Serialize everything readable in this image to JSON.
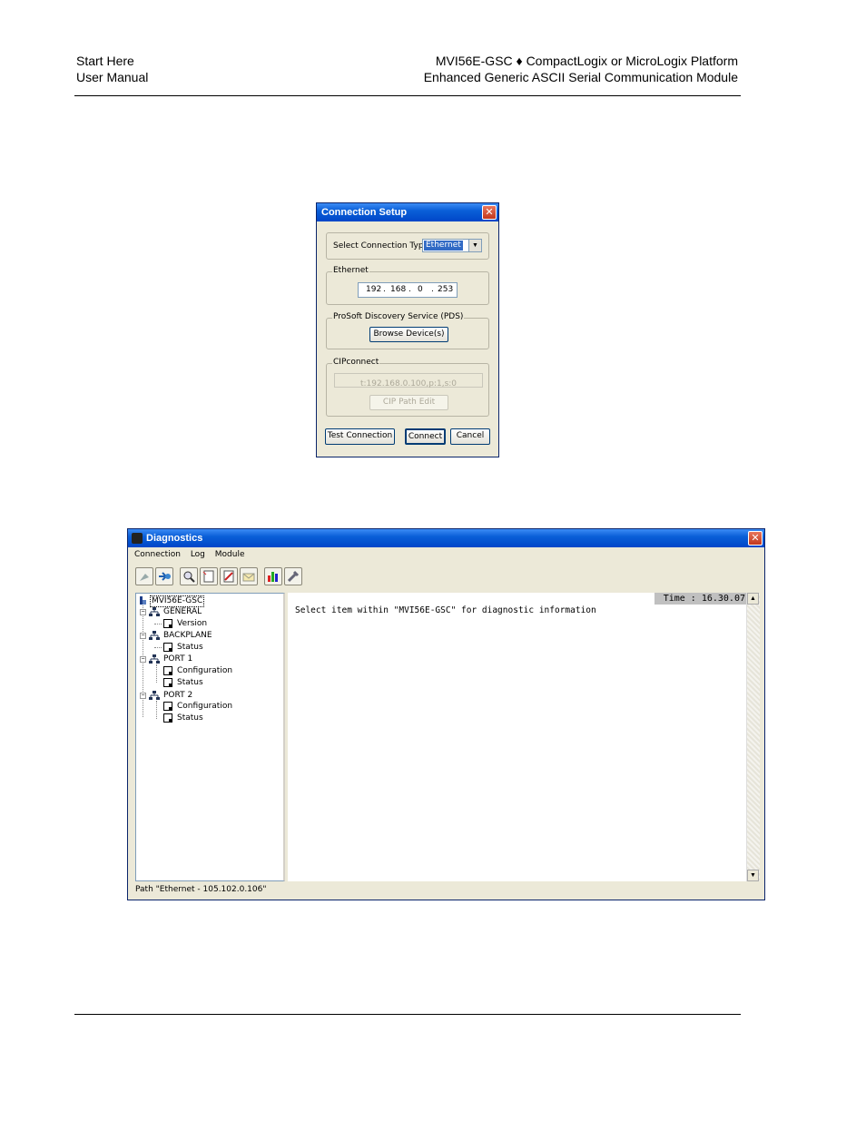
{
  "header": {
    "left_line1": "Start Here",
    "left_line2": "User Manual",
    "right_line1": "MVI56E-GSC ♦ CompactLogix or MicroLogix Platform",
    "right_line2": "Enhanced Generic ASCII Serial Communication Module"
  },
  "connection_setup": {
    "title": "Connection Setup",
    "select_label": "Select Connection Type:",
    "connection_type": "Ethernet",
    "ethernet_group": "Ethernet",
    "ip": [
      "192",
      "168",
      "0",
      "253"
    ],
    "pds_group": "ProSoft Discovery Service (PDS)",
    "browse_button": "Browse Device(s)",
    "cip_group": "CIPconnect",
    "cip_path": "t:192.168.0.100,p:1,s:0",
    "cip_edit_button": "CIP Path Edit",
    "test_button": "Test Connection",
    "connect_button": "Connect",
    "cancel_button": "Cancel"
  },
  "diagnostics": {
    "title": "Diagnostics",
    "menu": [
      "Connection",
      "Log",
      "Module"
    ],
    "tree": {
      "root": "MVI56E-GSC",
      "nodes": [
        {
          "label": "GENERAL",
          "children": [
            "Version"
          ]
        },
        {
          "label": "BACKPLANE",
          "children": [
            "Status"
          ]
        },
        {
          "label": "PORT 1",
          "children": [
            "Configuration",
            "Status"
          ]
        },
        {
          "label": "PORT 2",
          "children": [
            "Configuration",
            "Status"
          ]
        }
      ]
    },
    "time_label": "Time : 16.30.07",
    "message": "Select item within \"MVI56E-GSC\" for diagnostic information",
    "status_path": "Path \"Ethernet - 105.102.0.106\""
  }
}
